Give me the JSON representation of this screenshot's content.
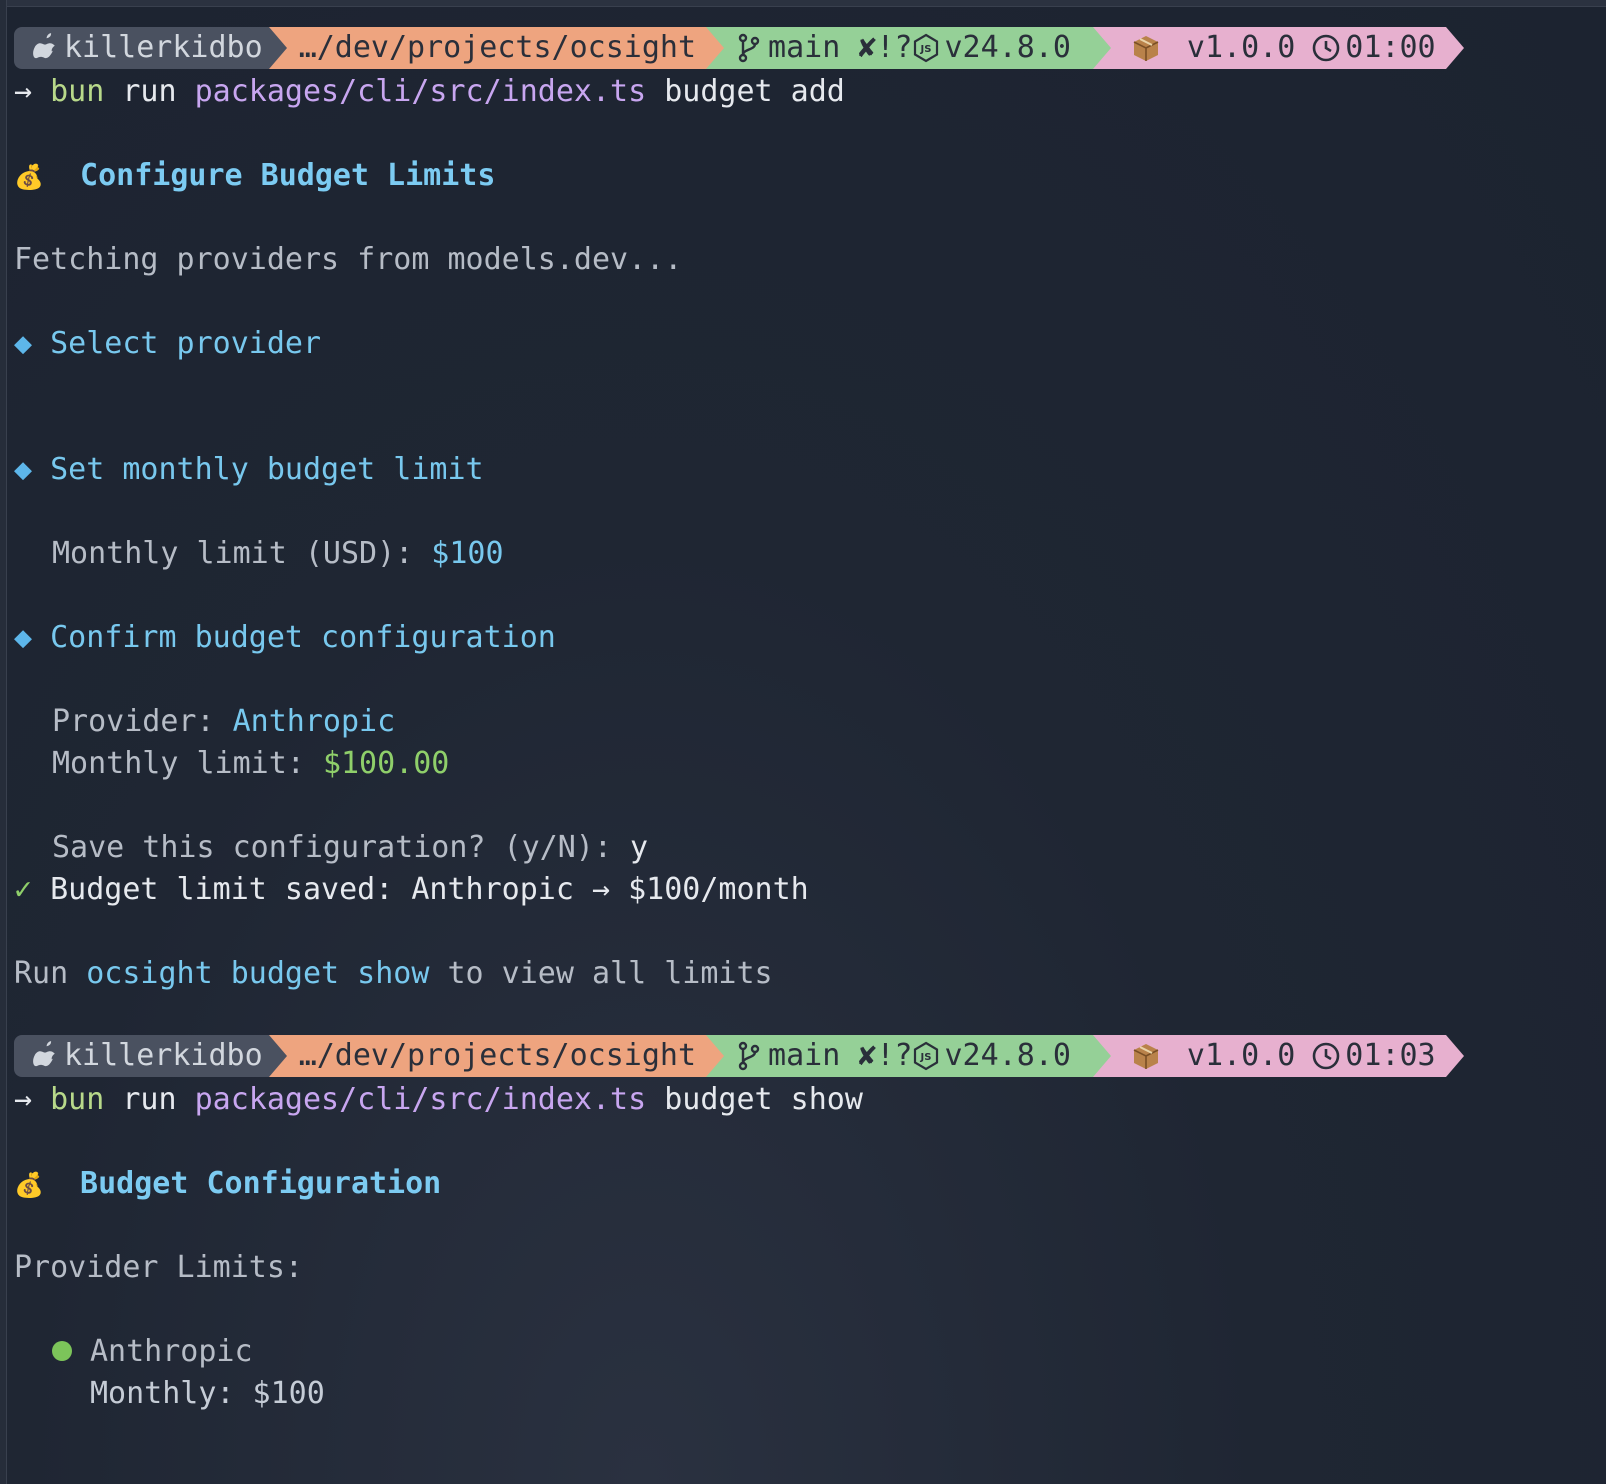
{
  "colors": {
    "user_seg": "#4a5160",
    "path_seg": "#eea47f",
    "git_seg": "#95d097",
    "version_seg": "#e7b0cf",
    "accent": "#78c8ee",
    "success": "#8fcf6a"
  },
  "prompts": [
    {
      "user": "killerkidbo",
      "path": "…/dev/projects/ocsight",
      "branch": "main",
      "git_status": "✘!?",
      "node_version": "v24.8.0",
      "pkg_version": "v1.0.0",
      "time": "01:00",
      "cmd": {
        "arrow": "→",
        "bin": "bun",
        "verb": "run",
        "file": "packages/cli/src/index.ts",
        "args": "budget add"
      }
    },
    {
      "user": "killerkidbo",
      "path": "…/dev/projects/ocsight",
      "branch": "main",
      "git_status": "✘!?",
      "node_version": "v24.8.0",
      "pkg_version": "v1.0.0",
      "time": "01:03",
      "cmd": {
        "arrow": "→",
        "bin": "bun",
        "verb": "run",
        "file": "packages/cli/src/index.ts",
        "args": "budget show"
      }
    }
  ],
  "add_output": {
    "emoji": "💰",
    "title": "Configure Budget Limits",
    "fetching": "Fetching providers from models.dev...",
    "diamond": "◆",
    "step1": "Select provider",
    "step2": "Set monthly budget limit",
    "monthly_label": "Monthly limit (USD):",
    "monthly_value": "$100",
    "step3": "Confirm budget configuration",
    "provider_label": "Provider:",
    "provider_value": "Anthropic",
    "limit_label": "Monthly limit:",
    "limit_value": "$100.00",
    "save_prompt": "Save this configuration? (y/N):",
    "save_answer": "y",
    "check": "✓",
    "saved_msg": "Budget limit saved: Anthropic → $100/month",
    "run_prefix": "Run",
    "run_cmd": "ocsight budget show",
    "run_suffix": "to view all limits"
  },
  "show_output": {
    "emoji": "💰",
    "title": "Budget Configuration",
    "section": "Provider Limits:",
    "providers": [
      {
        "name": "Anthropic",
        "monthly": "Monthly: $100"
      }
    ]
  }
}
